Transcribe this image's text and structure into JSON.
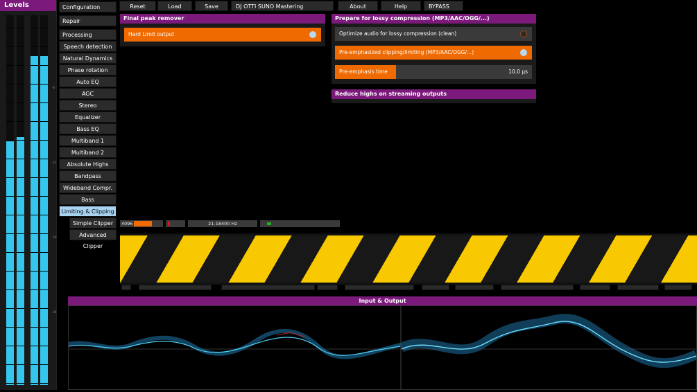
{
  "levels": {
    "title": "Levels",
    "meters": [
      0.66,
      0.67,
      0.89,
      0.89
    ],
    "ticks": [
      "-6",
      "-12",
      "-18",
      "-24"
    ]
  },
  "menu": {
    "top": [
      "Configuration",
      "Repair",
      "Processing"
    ],
    "processing": [
      "Speech detection",
      "Natural Dynamics",
      "Phase rotation",
      "Auto EQ",
      "AGC",
      "Stereo",
      "Equalizer",
      "Bass EQ",
      "Multiband 1",
      "Multiband 2",
      "Absolute Highs",
      "Bandpass",
      "Wideband Compr.",
      "Bass",
      "Limiting & Clipping"
    ],
    "limiting_sub": [
      "Simple Clipper",
      "Advanced Clipper"
    ]
  },
  "toolbar": {
    "reset": "Reset",
    "load": "Load",
    "save": "Save",
    "preset": "DJ OTTI SUNO Mastering",
    "about": "About",
    "help": "Help",
    "bypass": "BYPASS"
  },
  "final_peak": {
    "title": "Final peak remover",
    "hard_limit_label": "Hard Limit output",
    "hard_limit_on": true
  },
  "lossy": {
    "title": "Prepare for lossy compression (MP3/AAC/OGG/...)",
    "optimize_label": "Optimize audio for lossy compression (clean)",
    "optimize_on": false,
    "preemph_label": "Pre-emphasized clipping/limiting (MP3/AAC/OGG/...)",
    "preemph_on": true,
    "time_label": "Pre-emphasis time",
    "time_value": "10.0 µs",
    "time_fraction": 0.31
  },
  "streaming": {
    "title": "Reduce highs on streaming outputs"
  },
  "status": {
    "buffer": "4096",
    "freq_range": "21-18400 Hz"
  },
  "waveform": {
    "title": "Input & Output"
  },
  "colors": {
    "accent_purple": "#7b1a7b",
    "orange": "#ef6a00",
    "meter_cyan": "#35c6ee",
    "hazard_yellow": "#f8c800"
  }
}
